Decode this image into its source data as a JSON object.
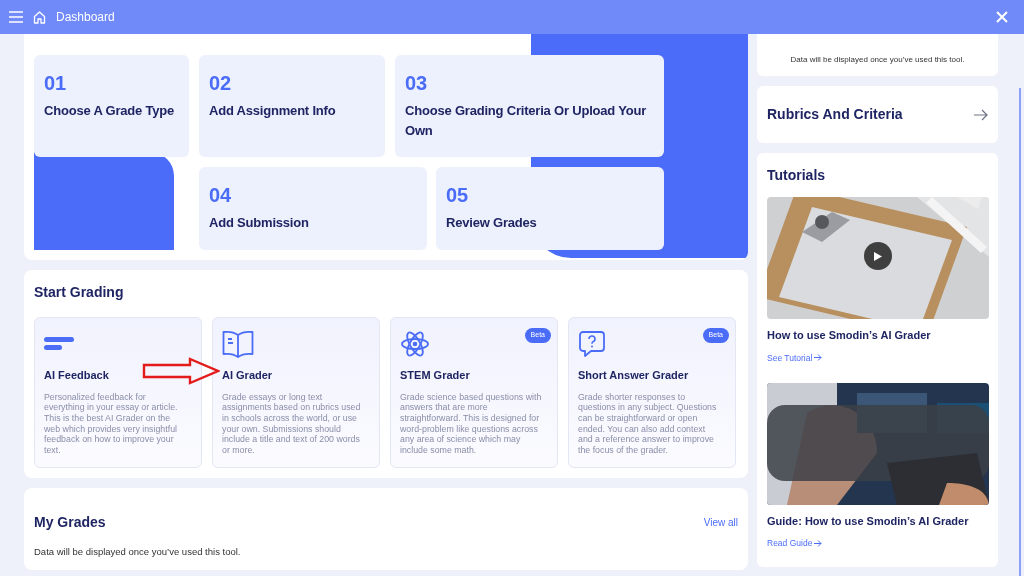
{
  "header": {
    "title": "Dashboard"
  },
  "getting_started": {
    "steps": [
      {
        "number": "01",
        "title": "Choose A Grade Type"
      },
      {
        "number": "02",
        "title": "Add Assignment Info"
      },
      {
        "number": "03",
        "title": "Choose Grading Criteria Or Upload Your Own"
      },
      {
        "number": "04",
        "title": "Add Submission"
      },
      {
        "number": "05",
        "title": "Review Grades"
      }
    ]
  },
  "start_grading": {
    "title": "Start Grading",
    "tools": [
      {
        "kind": "feedback",
        "title": "AI Feedback",
        "description": "Personalized feedback for everything in your essay or article. This is the best AI Grader on the web which provides very insightful feedback on how to improve your text."
      },
      {
        "kind": "grader",
        "title": "AI Grader",
        "description": "Grade essays or long text assignments based on rubrics used in schools across the world, or use your own. Submissions should include a title and text of 200 words or more."
      },
      {
        "kind": "stem",
        "title": "STEM Grader",
        "badge": "Beta",
        "description": "Grade science based questions with answers that are more straightforward. This is designed for word-problem like questions across any area of science which may include some math."
      },
      {
        "kind": "short_answer",
        "title": "Short Answer Grader",
        "badge": "Beta",
        "description": "Grade shorter responses to questions in any subject. Questions can be straightforward or open ended. You can also add context and a reference answer to improve the focus of the grader."
      }
    ]
  },
  "my_grades": {
    "title": "My Grades",
    "link": "View all",
    "empty_message": "Data will be displayed once you’ve used this tool."
  },
  "bulk_submission": {
    "empty_message": "Data will be displayed once you’ve used this tool."
  },
  "rubrics": {
    "title": "Rubrics And Criteria"
  },
  "tutorials": {
    "title": "Tutorials",
    "items": [
      {
        "kind": "clipboard",
        "title": "How to use Smodin’s AI Grader",
        "link": "See Tutorial",
        "video": true
      },
      {
        "kind": "tech",
        "title": "Guide: How to use Smodin’s AI Grader",
        "link": "Read Guide",
        "video": false
      }
    ]
  }
}
